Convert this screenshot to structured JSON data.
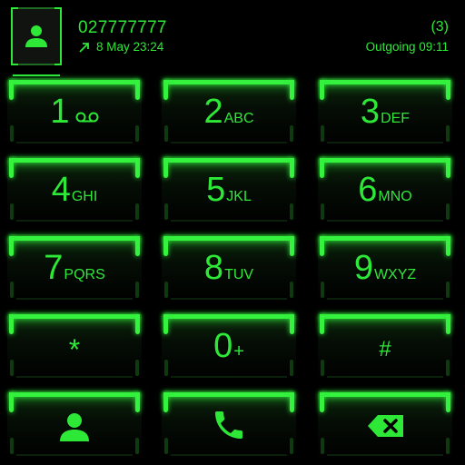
{
  "header": {
    "number": "027777777",
    "date": "8 May 23:24",
    "count": "(3)",
    "status": "Outgoing 09:11",
    "avatar_icon": "contact-icon",
    "direction_icon": "outgoing-arrow-icon"
  },
  "keypad": [
    {
      "digit": "1",
      "letters": "",
      "icon": "voicemail-icon"
    },
    {
      "digit": "2",
      "letters": "ABC"
    },
    {
      "digit": "3",
      "letters": "DEF"
    },
    {
      "digit": "4",
      "letters": "GHI"
    },
    {
      "digit": "5",
      "letters": "JKL"
    },
    {
      "digit": "6",
      "letters": "MNO"
    },
    {
      "digit": "7",
      "letters": "PQRS"
    },
    {
      "digit": "8",
      "letters": "TUV"
    },
    {
      "digit": "9",
      "letters": "WXYZ"
    },
    {
      "digit": "*",
      "letters": ""
    },
    {
      "digit": "0",
      "letters": "+"
    },
    {
      "digit": "#",
      "letters": ""
    }
  ],
  "actions": {
    "contacts_icon": "contact-icon",
    "call_icon": "phone-icon",
    "delete_icon": "backspace-icon"
  },
  "colors": {
    "accent": "#2ee838",
    "background": "#000000"
  }
}
